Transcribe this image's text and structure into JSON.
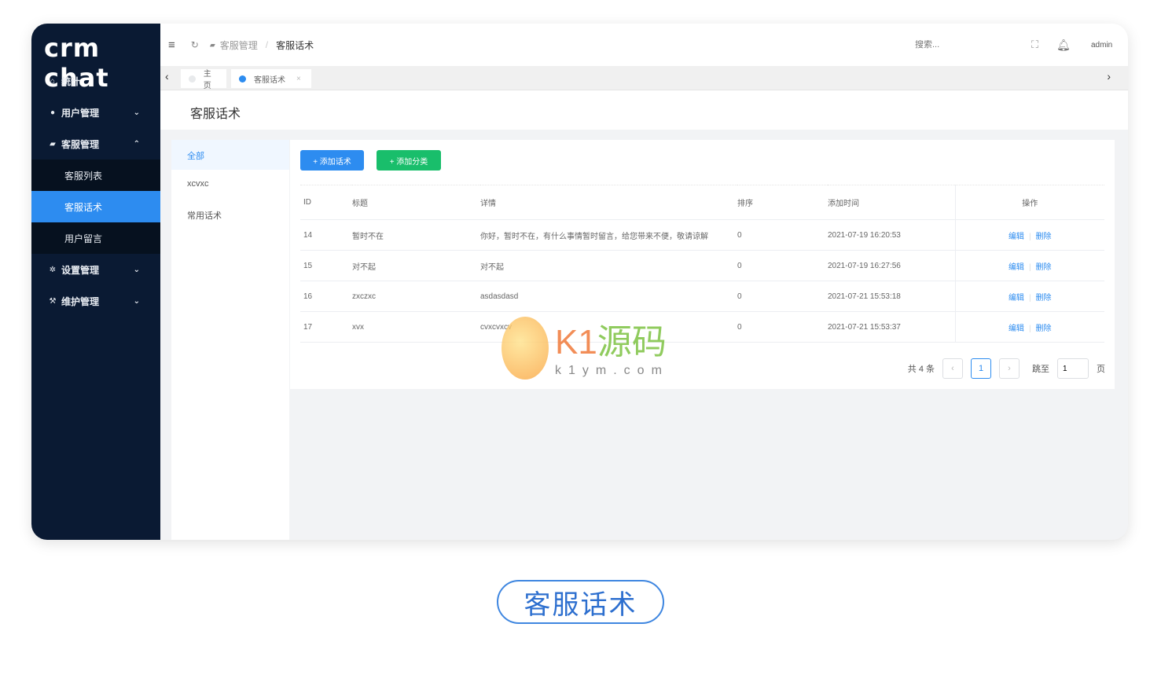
{
  "logo": "crm chat",
  "sidebar": {
    "items": [
      {
        "label": "统计",
        "icon": "home-icon"
      },
      {
        "label": "用户管理",
        "icon": "user-icon"
      },
      {
        "label": "客服管理",
        "icon": "chat-icon"
      },
      {
        "label": "客服列表"
      },
      {
        "label": "客服话术"
      },
      {
        "label": "用户留言"
      },
      {
        "label": "设置管理",
        "icon": "gear-icon"
      },
      {
        "label": "维护管理",
        "icon": "wrench-icon"
      }
    ]
  },
  "header": {
    "breadcrumb": [
      "客服管理",
      "客服话术"
    ],
    "sep": "/",
    "search_placeholder": "搜索...",
    "user": "admin"
  },
  "tabs": [
    {
      "label": "主页"
    },
    {
      "label": "客服话术",
      "close": "×"
    }
  ],
  "page_title": "客服话术",
  "categories": [
    "全部",
    "xcvxc",
    "常用话术"
  ],
  "buttons": {
    "add_script": "+ 添加话术",
    "add_category": "+ 添加分类"
  },
  "table": {
    "columns": [
      "ID",
      "标题",
      "详情",
      "排序",
      "添加时间",
      "操作"
    ],
    "rows": [
      {
        "id": "14",
        "title": "暂时不在",
        "detail": "你好，暂时不在，有什么事情暂时留言，给您带来不便，敬请谅解",
        "sort": "0",
        "time": "2021-07-19 16:20:53"
      },
      {
        "id": "15",
        "title": "对不起",
        "detail": "对不起",
        "sort": "0",
        "time": "2021-07-19 16:27:56"
      },
      {
        "id": "16",
        "title": "zxczxc",
        "detail": "asdasdasd",
        "sort": "0",
        "time": "2021-07-21 15:53:18"
      },
      {
        "id": "17",
        "title": "xvx",
        "detail": "cvxcvxcv",
        "sort": "0",
        "time": "2021-07-21 15:53:37"
      }
    ],
    "edit": "编辑",
    "delete": "删除"
  },
  "pagination": {
    "total": "共 4 条",
    "current": "1",
    "jump_label": "跳至",
    "jump_value": "1",
    "page_suffix": "页"
  },
  "watermark": {
    "brand": "K1源码",
    "url": "k1ym.com"
  },
  "caption": "客服话术",
  "colors": {
    "sidebar": "#0a1a33",
    "primary": "#2d8cf0",
    "success": "#19be6b"
  }
}
